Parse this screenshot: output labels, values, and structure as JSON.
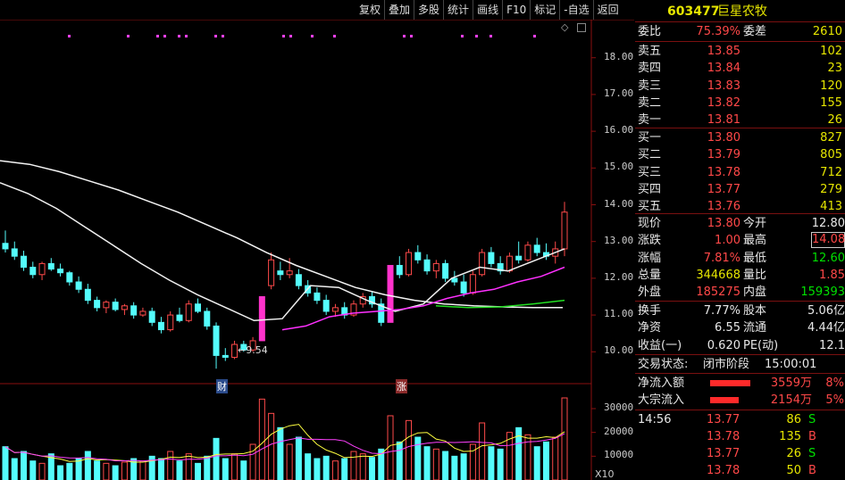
{
  "toolbar": {
    "items": [
      "复权",
      "叠加",
      "多股",
      "统计",
      "画线",
      "F10",
      "标记",
      "-自选",
      "返回"
    ]
  },
  "stock": {
    "code": "603477",
    "name": "巨星农牧"
  },
  "committee": {
    "ratio_label": "委比",
    "ratio_value": "75.39%",
    "diff_label": "委差",
    "diff_value": "2610"
  },
  "asks": [
    {
      "label": "卖五",
      "price": "13.85",
      "vol": "102"
    },
    {
      "label": "卖四",
      "price": "13.84",
      "vol": "23"
    },
    {
      "label": "卖三",
      "price": "13.83",
      "vol": "120"
    },
    {
      "label": "卖二",
      "price": "13.82",
      "vol": "155"
    },
    {
      "label": "卖一",
      "price": "13.81",
      "vol": "26"
    }
  ],
  "bids": [
    {
      "label": "买一",
      "price": "13.80",
      "vol": "827"
    },
    {
      "label": "买二",
      "price": "13.79",
      "vol": "805"
    },
    {
      "label": "买三",
      "price": "13.78",
      "vol": "712"
    },
    {
      "label": "买四",
      "price": "13.77",
      "vol": "279"
    },
    {
      "label": "买五",
      "price": "13.76",
      "vol": "413"
    }
  ],
  "quote": [
    {
      "l1": "现价",
      "v1": "13.80",
      "l2": "今开",
      "v2": "12.80"
    },
    {
      "l1": "涨跌",
      "v1": "1.00",
      "l2": "最高",
      "v2": "14.08"
    },
    {
      "l1": "涨幅",
      "v1": "7.81%",
      "l2": "最低",
      "v2": "12.60"
    },
    {
      "l1": "总量",
      "v1": "344668",
      "l2": "量比",
      "v2": "1.85"
    },
    {
      "l1": "外盘",
      "v1": "185275",
      "l2": "内盘",
      "v2": "159393"
    }
  ],
  "fundamentals": [
    {
      "l1": "换手",
      "v1": "7.77%",
      "l2": "股本",
      "v2": "5.06亿"
    },
    {
      "l1": "净资",
      "v1": "6.55",
      "l2": "流通",
      "v2": "4.44亿"
    },
    {
      "l1": "收益(一)",
      "v1": "0.620",
      "l2": "PE(动)",
      "v2": "12.1"
    }
  ],
  "trade_status": {
    "label": "交易状态:",
    "value": "闭市阶段",
    "time": "15:00:01"
  },
  "flows": [
    {
      "label": "净流入额",
      "amount": "3559万",
      "pct": "8%",
      "bar_fraction": 0.45
    },
    {
      "label": "大宗流入",
      "amount": "2154万",
      "pct": "5%",
      "bar_fraction": 0.32
    }
  ],
  "ticks": [
    {
      "time": "14:56",
      "price": "13.77",
      "vol": "86",
      "side": "S"
    },
    {
      "time": "",
      "price": "13.78",
      "vol": "135",
      "side": "B"
    },
    {
      "time": "",
      "price": "13.77",
      "vol": "26",
      "side": "S"
    },
    {
      "time": "",
      "price": "13.78",
      "vol": "50",
      "side": "B"
    }
  ],
  "chart_labels": {
    "low_marker": "9.54",
    "event1": "财",
    "event2": "涨",
    "vol_unit": "X10",
    "diamond": "◇"
  },
  "chart_data": {
    "type": "candlestick",
    "price_axis": {
      "ticks": [
        "18.00",
        "17.00",
        "16.00",
        "15.00",
        "14.00",
        "13.00",
        "12.00",
        "11.00",
        "10.00"
      ],
      "range": [
        9.4,
        18.6
      ]
    },
    "volume_axis": {
      "ticks": [
        "30000",
        "20000",
        "10000"
      ],
      "range": [
        0,
        36000
      ]
    },
    "candles": [
      [
        12.95,
        13.3,
        12.7,
        12.8
      ],
      [
        12.8,
        13.0,
        12.5,
        12.6
      ],
      [
        12.6,
        12.75,
        12.2,
        12.3
      ],
      [
        12.3,
        12.45,
        12.0,
        12.1
      ],
      [
        12.1,
        12.45,
        11.95,
        12.4
      ],
      [
        12.4,
        12.55,
        12.2,
        12.25
      ],
      [
        12.25,
        12.4,
        12.05,
        12.15
      ],
      [
        12.15,
        12.2,
        11.8,
        11.9
      ],
      [
        11.9,
        12.05,
        11.6,
        11.7
      ],
      [
        11.7,
        11.85,
        11.3,
        11.4
      ],
      [
        11.4,
        11.5,
        11.1,
        11.2
      ],
      [
        11.2,
        11.4,
        11.05,
        11.35
      ],
      [
        11.35,
        11.45,
        11.1,
        11.15
      ],
      [
        11.15,
        11.3,
        11.0,
        11.25
      ],
      [
        11.25,
        11.35,
        10.9,
        11.0
      ],
      [
        11.0,
        11.2,
        10.95,
        11.1
      ],
      [
        11.1,
        11.2,
        10.7,
        10.8
      ],
      [
        10.8,
        10.95,
        10.5,
        10.6
      ],
      [
        10.6,
        11.1,
        10.55,
        11.0
      ],
      [
        11.0,
        11.2,
        10.8,
        10.85
      ],
      [
        10.85,
        11.4,
        10.8,
        11.3
      ],
      [
        11.3,
        11.45,
        11.05,
        11.1
      ],
      [
        11.1,
        11.2,
        10.6,
        10.7
      ],
      [
        10.7,
        10.8,
        9.54,
        9.9
      ],
      [
        9.9,
        10.1,
        9.75,
        9.85
      ],
      [
        9.85,
        10.3,
        9.8,
        10.2
      ],
      [
        10.2,
        10.3,
        10.0,
        10.05
      ],
      [
        10.05,
        10.4,
        10.0,
        10.3
      ],
      [
        10.3,
        11.5,
        10.3,
        11.5
      ],
      [
        11.8,
        12.7,
        11.7,
        12.5
      ],
      [
        12.2,
        12.45,
        11.95,
        12.1
      ],
      [
        12.1,
        12.55,
        12.0,
        12.2
      ],
      [
        12.1,
        12.25,
        11.7,
        11.8
      ],
      [
        11.8,
        11.95,
        11.5,
        11.6
      ],
      [
        11.6,
        11.75,
        11.3,
        11.4
      ],
      [
        11.4,
        11.55,
        11.0,
        11.1
      ],
      [
        11.1,
        11.3,
        10.95,
        11.2
      ],
      [
        11.2,
        11.35,
        10.9,
        11.0
      ],
      [
        11.0,
        11.4,
        10.95,
        11.3
      ],
      [
        11.3,
        11.6,
        11.2,
        11.5
      ],
      [
        11.5,
        11.65,
        11.2,
        11.3
      ],
      [
        11.3,
        11.45,
        10.7,
        10.8
      ],
      [
        10.8,
        12.35,
        10.8,
        12.35
      ],
      [
        12.35,
        12.6,
        12.0,
        12.1
      ],
      [
        12.1,
        12.8,
        12.05,
        12.7
      ],
      [
        12.7,
        12.9,
        12.4,
        12.5
      ],
      [
        12.5,
        12.65,
        12.1,
        12.2
      ],
      [
        12.2,
        12.5,
        12.0,
        12.4
      ],
      [
        12.4,
        12.5,
        11.9,
        12.0
      ],
      [
        12.0,
        12.2,
        11.8,
        11.9
      ],
      [
        11.9,
        12.1,
        11.5,
        11.6
      ],
      [
        11.6,
        12.2,
        11.55,
        12.1
      ],
      [
        12.1,
        12.8,
        12.05,
        12.7
      ],
      [
        12.7,
        12.85,
        12.3,
        12.4
      ],
      [
        12.4,
        12.6,
        12.1,
        12.2
      ],
      [
        12.2,
        12.7,
        12.15,
        12.6
      ],
      [
        12.6,
        13.0,
        12.4,
        12.5
      ],
      [
        12.5,
        13.0,
        12.45,
        12.9
      ],
      [
        12.9,
        13.1,
        12.6,
        12.7
      ],
      [
        12.7,
        12.95,
        12.5,
        12.6
      ],
      [
        12.6,
        13.0,
        12.4,
        12.8
      ],
      [
        12.8,
        14.08,
        12.6,
        13.8
      ]
    ],
    "volumes": [
      14000,
      9000,
      12000,
      8000,
      7000,
      11000,
      6000,
      7000,
      9000,
      12000,
      8000,
      7000,
      6000,
      7500,
      9000,
      8000,
      10000,
      9000,
      12000,
      8000,
      11000,
      7000,
      10000,
      17500,
      9000,
      11000,
      8000,
      15000,
      34000,
      28000,
      22000,
      15000,
      18000,
      11000,
      9000,
      10000,
      8000,
      9000,
      12000,
      11000,
      9500,
      13000,
      27000,
      16000,
      25000,
      18000,
      14000,
      13000,
      12000,
      10000,
      11000,
      15000,
      24000,
      14000,
      13000,
      20000,
      22000,
      19000,
      14000,
      16000,
      18000,
      34500
    ],
    "ma_white_slow": [
      15.2,
      15.1,
      14.9,
      14.65,
      14.4,
      14.1,
      13.8,
      13.45,
      13.1,
      12.7,
      12.35,
      12.05,
      11.75,
      11.55,
      11.4,
      11.3,
      11.25,
      11.22,
      11.2,
      11.2
    ],
    "ma_white_fast": [
      14.6,
      14.3,
      13.9,
      13.4,
      12.9,
      12.4,
      11.95,
      11.55,
      11.2,
      10.85,
      10.9,
      11.8,
      11.75,
      11.4,
      11.1,
      11.3,
      12.0,
      12.3,
      12.2,
      12.5,
      12.8
    ],
    "ma_magenta": [
      10.6,
      10.7,
      10.95,
      11.05,
      11.1,
      11.15,
      11.25,
      11.45,
      11.6,
      11.7,
      11.9,
      12.05,
      12.3
    ],
    "ma_green": [
      11.25,
      11.2,
      11.22,
      11.3,
      11.4
    ]
  }
}
